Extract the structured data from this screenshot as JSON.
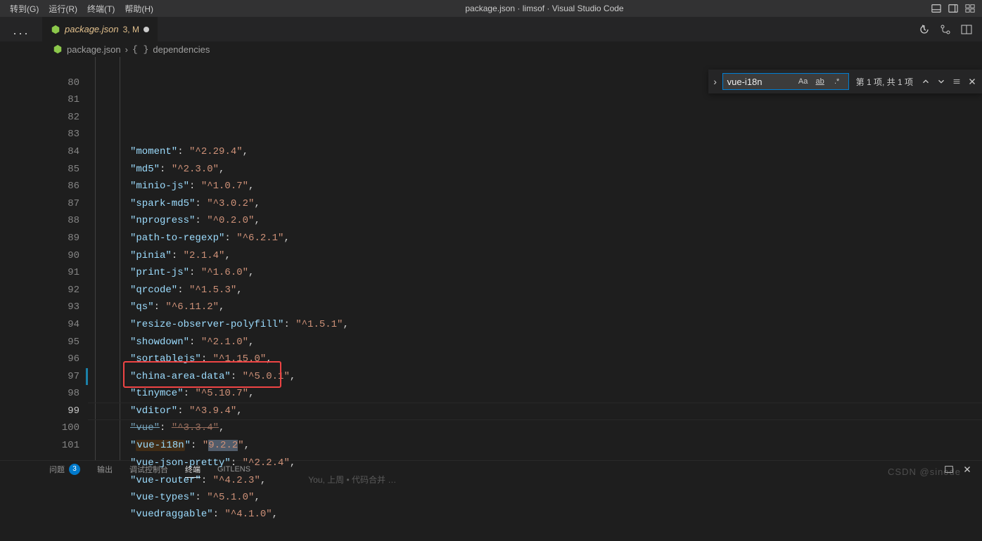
{
  "titlebar": {
    "menus": [
      "转到(G)",
      "运行(R)",
      "终端(T)",
      "帮助(H)"
    ],
    "title": "package.json · limsof · Visual Studio Code"
  },
  "tab": {
    "name": "package.json",
    "status": "3, M"
  },
  "breadcrumb": {
    "file": "package.json",
    "section": "dependencies"
  },
  "find": {
    "query": "vue-i18n",
    "status": "第 1 项, 共 1 项",
    "case_label": "Aa",
    "word_label": "ab",
    "regex_label": ".*",
    "toggle_glyph": "›"
  },
  "code_lines": [
    {
      "num": 80,
      "key": "moment",
      "val": "^2.29.4"
    },
    {
      "num": 81,
      "key": "md5",
      "val": "^2.3.0"
    },
    {
      "num": 82,
      "key": "minio-js",
      "val": "^1.0.7"
    },
    {
      "num": 83,
      "key": "spark-md5",
      "val": "^3.0.2"
    },
    {
      "num": 84,
      "key": "nprogress",
      "val": "^0.2.0"
    },
    {
      "num": 85,
      "key": "path-to-regexp",
      "val": "^6.2.1"
    },
    {
      "num": 86,
      "key": "pinia",
      "val": "2.1.4"
    },
    {
      "num": 87,
      "key": "print-js",
      "val": "^1.6.0"
    },
    {
      "num": 88,
      "key": "qrcode",
      "val": "^1.5.3"
    },
    {
      "num": 89,
      "key": "qs",
      "val": "^6.11.2"
    },
    {
      "num": 90,
      "key": "resize-observer-polyfill",
      "val": "^1.5.1"
    },
    {
      "num": 91,
      "key": "showdown",
      "val": "^2.1.0"
    },
    {
      "num": 92,
      "key": "sortablejs",
      "val": "^1.15.0"
    },
    {
      "num": 93,
      "key": "china-area-data",
      "val": "^5.0.1"
    },
    {
      "num": 94,
      "key": "tinymce",
      "val": "^5.10.7"
    },
    {
      "num": 95,
      "key": "vditor",
      "val": "^3.9.4"
    },
    {
      "num": 96,
      "key": "vue",
      "val": "^3.3.4",
      "strike": true
    },
    {
      "num": 97,
      "key": "vue-i18n",
      "val": "9.2.2",
      "highlight": true,
      "modified": true
    },
    {
      "num": 98,
      "key": "vue-json-pretty",
      "val": "^2.2.4"
    },
    {
      "num": 99,
      "key": "vue-router",
      "val": "^4.2.3",
      "current": true,
      "lens": "You, 上周 • 代码合并 …"
    },
    {
      "num": 100,
      "key": "vue-types",
      "val": "^5.1.0"
    },
    {
      "num": 101,
      "key": "vuedraggable",
      "val": "^4.1.0"
    }
  ],
  "panel": {
    "tabs": [
      "问题",
      "输出",
      "调试控制台",
      "终端",
      "GITLENS"
    ],
    "problem_count": "3"
  },
  "watermark": "CSDN @sinode"
}
